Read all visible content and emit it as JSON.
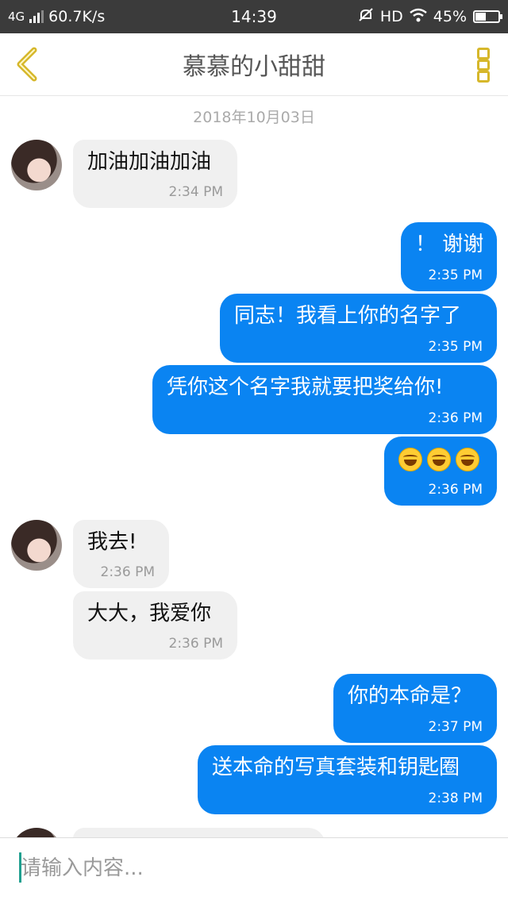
{
  "status_bar": {
    "network": "4G",
    "speed": "60.7K/s",
    "time": "14:39",
    "hd": "HD",
    "battery": "45%"
  },
  "header": {
    "title": "慕慕的小甜甜",
    "accent_color": "#d6b72a"
  },
  "chat": {
    "date": "2018年10月03日",
    "messages": [
      {
        "side": "in",
        "text": "加油加油加油",
        "time": "2:34 PM"
      },
      {
        "side": "out",
        "text": "！ 谢谢",
        "time": "2:35 PM"
      },
      {
        "side": "out",
        "text": "同志！我看上你的名字了",
        "time": "2:35 PM"
      },
      {
        "side": "out",
        "text": "凭你这个名字我就要把奖给你!",
        "time": "2:36 PM"
      },
      {
        "side": "out",
        "emoji": [
          "laughing-emoji",
          "laughing-emoji",
          "laughing-emoji"
        ],
        "time": "2:36 PM"
      },
      {
        "side": "in",
        "text": "我去!",
        "time": "2:36 PM"
      },
      {
        "side": "in",
        "text": "大大，我爱你",
        "time": "2:36 PM"
      },
      {
        "side": "out",
        "text": "你的本命是？",
        "time": "2:37 PM"
      },
      {
        "side": "out",
        "text": "送本命的写真套装和钥匙圈",
        "time": "2:38 PM"
      }
    ],
    "outgoing_color": "#0a84f2",
    "incoming_color": "#f0f0f0"
  },
  "input": {
    "placeholder": "请输入内容..."
  }
}
